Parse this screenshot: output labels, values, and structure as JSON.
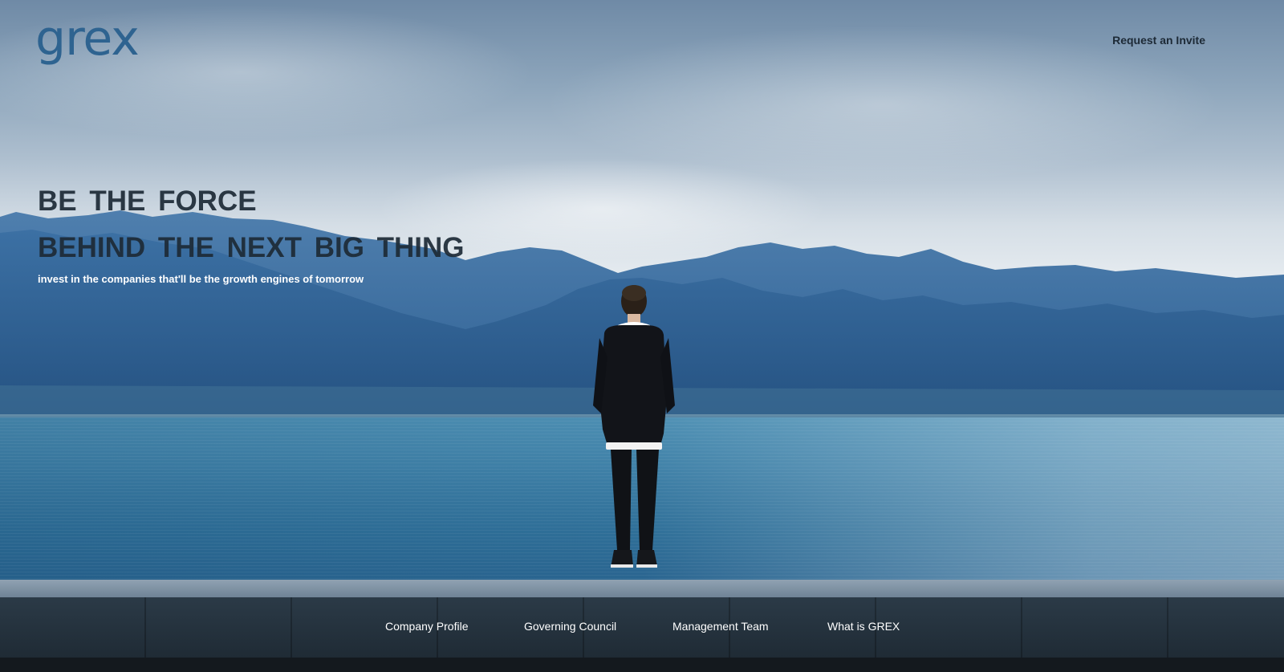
{
  "brand": {
    "logo_text": "grex",
    "logo_color": "#2e6390"
  },
  "header": {
    "invite_label": "Request an Invite"
  },
  "hero": {
    "headline_line1": "BE THE FORCE",
    "headline_line2": "BEHIND THE NEXT BIG THING",
    "subheadline": "invest in the companies that'll be the growth engines of tomorrow"
  },
  "footer_nav": [
    {
      "label": "Company Profile"
    },
    {
      "label": "Governing Council"
    },
    {
      "label": "Management Team"
    },
    {
      "label": "What is GREX"
    }
  ],
  "colors": {
    "headline": "#1d2a36",
    "subheadline": "#ffffff",
    "nav_text": "#ffffff"
  }
}
